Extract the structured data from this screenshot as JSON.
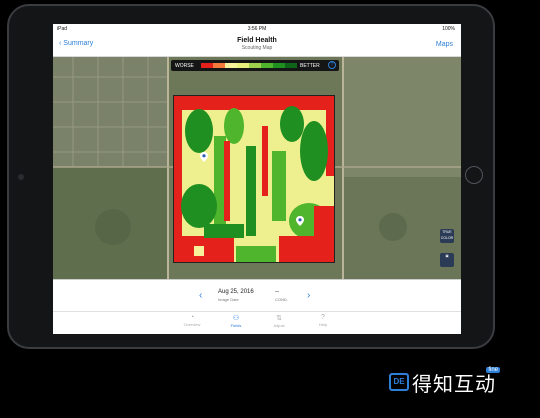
{
  "status_bar": {
    "carrier": "iPad",
    "time": "3:56 PM",
    "battery": "100%"
  },
  "nav": {
    "back_label": "Summary",
    "title": "Field Health",
    "subtitle": "Scouting Map",
    "maps_label": "Maps"
  },
  "legend": {
    "worse_label": "WORSE",
    "better_label": "BETTER",
    "help_label": "?",
    "colors": [
      "#e5211b",
      "#f37a3a",
      "#f6f19a",
      "#e9ef7c",
      "#9ed24c",
      "#4fb52c",
      "#1f8f21",
      "#0e6418"
    ]
  },
  "right_buttons": {
    "true_color_label": "TRUE COLOR",
    "camera_label": "PHOTO"
  },
  "bottom": {
    "date_value": "Aug 25, 2016",
    "date_label": "Image Date",
    "cond_value": "--",
    "cond_label": "COND."
  },
  "tabs": [
    {
      "label": "Overview",
      "icon": "overview-icon"
    },
    {
      "label": "Fields",
      "icon": "fields-icon"
    },
    {
      "label": "Adjust",
      "icon": "adjust-icon"
    },
    {
      "label": "Help",
      "icon": "help-icon"
    }
  ],
  "brand": {
    "name": "得知互动",
    "fine": "fine",
    "logo": "DE"
  }
}
